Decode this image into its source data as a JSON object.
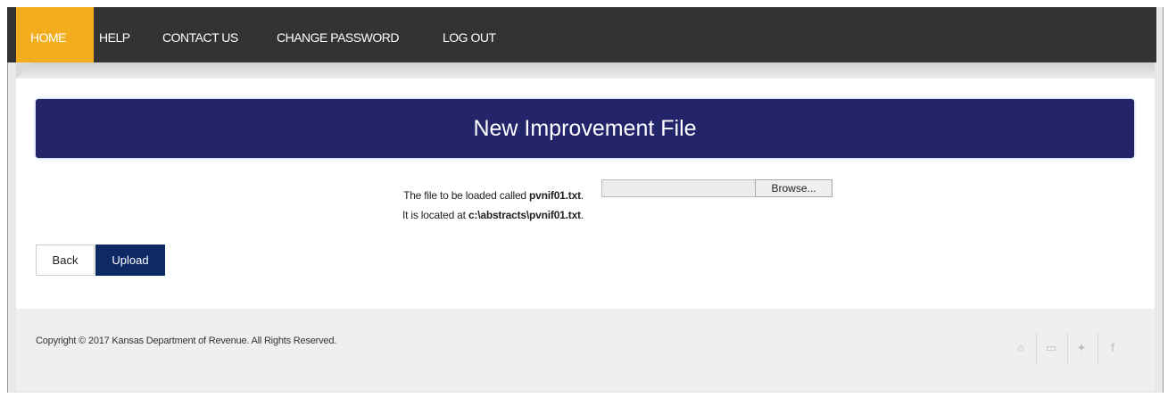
{
  "nav": {
    "items": [
      {
        "label": "HOME",
        "active": true
      },
      {
        "label": "HELP"
      },
      {
        "label": "CONTACT US"
      },
      {
        "label": "CHANGE PASSWORD"
      },
      {
        "label": "LOG OUT"
      }
    ],
    "active_color": "#f2ae1c",
    "background_color": "#333333"
  },
  "main": {
    "title": "New Improvement File",
    "title_color": "#24246b",
    "file_line_prefix": "The file to be loaded called",
    "file_name": "pvnif01.txt",
    "file_line_suffix": ".",
    "location_prefix": "It is located at",
    "location_path": "c:\\abstracts\\pvnif01.txt",
    "location_suffix": ".",
    "browse_label": "Browse...",
    "back_label": "Back",
    "upload_label": "Upload",
    "upload_color": "#0d2a66"
  },
  "footer": {
    "copyright": "Copyright © 2017 Kansas Department of Revenue. All Rights Reserved.",
    "social_icons": [
      "home-icon",
      "youtube-icon",
      "twitter-icon",
      "facebook-icon"
    ],
    "social_glyphs": {
      "home": "⌂",
      "youtube": "▭",
      "twitter": "✦",
      "facebook": "f"
    }
  }
}
